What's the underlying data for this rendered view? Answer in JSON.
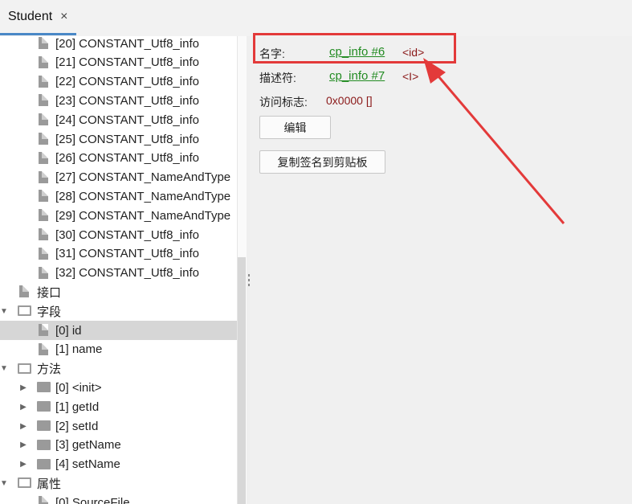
{
  "tab": {
    "title": "Student",
    "close_glyph": "×"
  },
  "tree": [
    {
      "label": "[20] CONSTANT_Utf8_info",
      "kind": "file",
      "level": 2
    },
    {
      "label": "[21] CONSTANT_Utf8_info",
      "kind": "file",
      "level": 2
    },
    {
      "label": "[22] CONSTANT_Utf8_info",
      "kind": "file",
      "level": 2
    },
    {
      "label": "[23] CONSTANT_Utf8_info",
      "kind": "file",
      "level": 2
    },
    {
      "label": "[24] CONSTANT_Utf8_info",
      "kind": "file",
      "level": 2
    },
    {
      "label": "[25] CONSTANT_Utf8_info",
      "kind": "file",
      "level": 2
    },
    {
      "label": "[26] CONSTANT_Utf8_info",
      "kind": "file",
      "level": 2
    },
    {
      "label": "[27] CONSTANT_NameAndType",
      "kind": "file",
      "level": 2
    },
    {
      "label": "[28] CONSTANT_NameAndType",
      "kind": "file",
      "level": 2
    },
    {
      "label": "[29] CONSTANT_NameAndType",
      "kind": "file",
      "level": 2
    },
    {
      "label": "[30] CONSTANT_Utf8_info",
      "kind": "file",
      "level": 2
    },
    {
      "label": "[31] CONSTANT_Utf8_info",
      "kind": "file",
      "level": 2
    },
    {
      "label": "[32] CONSTANT_Utf8_info",
      "kind": "file",
      "level": 2
    },
    {
      "label": "接口",
      "kind": "file",
      "level": 1
    },
    {
      "label": "字段",
      "kind": "folder-open",
      "level": 1,
      "arrow": "▼"
    },
    {
      "label": "[0] id",
      "kind": "file",
      "level": 2,
      "selected": true
    },
    {
      "label": "[1] name",
      "kind": "file",
      "level": 2
    },
    {
      "label": "方法",
      "kind": "folder-open",
      "level": 1,
      "arrow": "▼"
    },
    {
      "label": "[0] <init>",
      "kind": "folder",
      "level": 2,
      "arrow": "▶"
    },
    {
      "label": "[1] getId",
      "kind": "folder",
      "level": 2,
      "arrow": "▶"
    },
    {
      "label": "[2] setId",
      "kind": "folder",
      "level": 2,
      "arrow": "▶"
    },
    {
      "label": "[3] getName",
      "kind": "folder",
      "level": 2,
      "arrow": "▶"
    },
    {
      "label": "[4] setName",
      "kind": "folder",
      "level": 2,
      "arrow": "▶"
    },
    {
      "label": "属性",
      "kind": "folder-open",
      "level": 1,
      "arrow": "▼"
    },
    {
      "label": "[0] SourceFile",
      "kind": "file",
      "level": 2
    }
  ],
  "details": {
    "name_label": "名字:",
    "name_link": "cp_info #6",
    "name_value": "<id>",
    "descriptor_label": "描述符:",
    "descriptor_link": "cp_info #7",
    "descriptor_value": "<I>",
    "access_label": "访问标志:",
    "access_value": "0x0000 []",
    "edit_button": "编辑",
    "copy_button": "复制签名到剪贴板"
  },
  "colors": {
    "link": "#228b22",
    "value": "#8b1a1a",
    "annotation": "#e33a3a"
  }
}
